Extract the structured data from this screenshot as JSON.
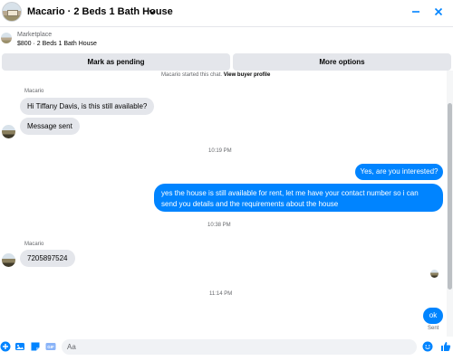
{
  "header": {
    "title": "Macario · 2 Beds 1 Bath House"
  },
  "listing": {
    "source": "Marketplace",
    "price_title": "$800 · 2 Beds 1 Bath House"
  },
  "actions": {
    "mark_pending": "Mark as pending",
    "more_options": "More options"
  },
  "thread": {
    "notice_text": "Macario started this chat.",
    "notice_link": "View buyer profile",
    "messages": [
      {
        "sender": "Macario",
        "text": "Hi Tiffany Davis, is this still available?"
      },
      {
        "text": "Message sent"
      },
      {
        "time": "10:19 PM"
      },
      {
        "text": "Yes, are you interested?"
      },
      {
        "text": "yes the house is still available for rent, let me have your contact number so i can send you details and the requirements about the house"
      },
      {
        "time": "10:38 PM"
      },
      {
        "sender": "Macario",
        "text": "7205897524"
      },
      {
        "time": "11:14 PM"
      },
      {
        "text": "ok",
        "status": "Sent"
      }
    ]
  },
  "composer": {
    "placeholder": "Aa"
  },
  "colors": {
    "accent": "#0084ff",
    "incoming_bubble": "#e4e6eb",
    "button_bg": "#e4e6eb"
  }
}
